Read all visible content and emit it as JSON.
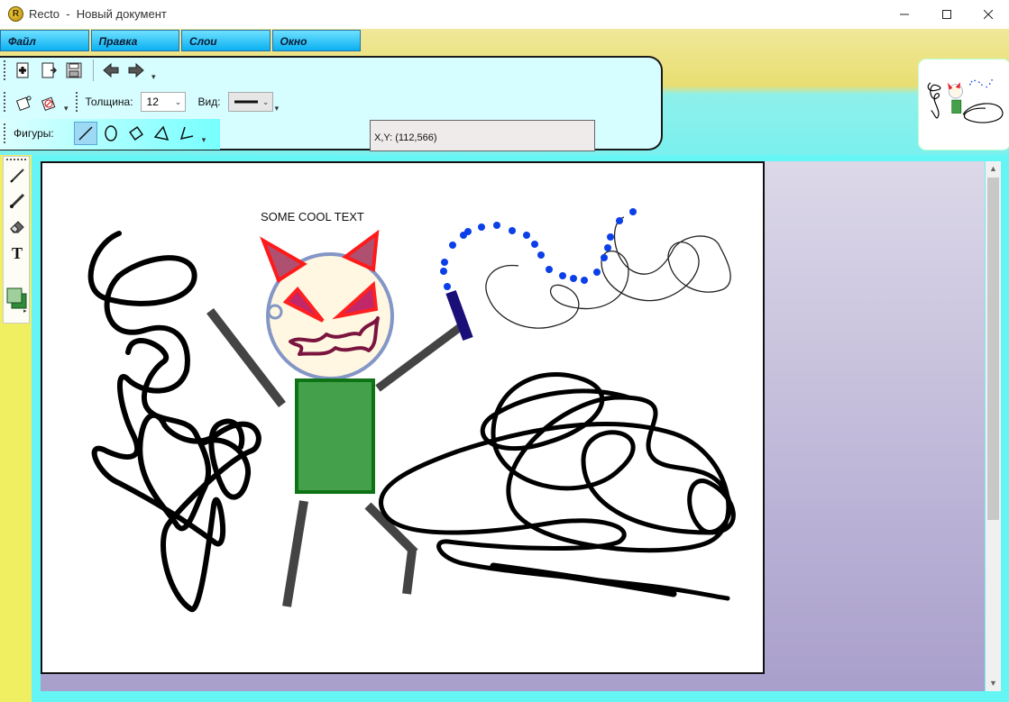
{
  "window": {
    "app_name": "Recto",
    "separator": "-",
    "document_title": "Новый документ",
    "logo_letter": "R"
  },
  "menu": [
    {
      "label": "Файл"
    },
    {
      "label": "Правка"
    },
    {
      "label": "Слои"
    },
    {
      "label": "Окно"
    }
  ],
  "toolbar": {
    "file_icons": [
      "new-document-icon",
      "open-document-icon",
      "save-icon",
      "undo-arrow-icon",
      "redo-arrow-icon"
    ],
    "thickness_label": "Толщина:",
    "thickness_value": "12",
    "style_label": "Вид:",
    "shapes_label": "Фигуры:",
    "shape_icons": [
      "line-icon",
      "ellipse-icon",
      "rhombus-icon",
      "triangle-icon",
      "polyline-icon"
    ],
    "selected_shape": "line-icon"
  },
  "status": {
    "coords": "X,Y: (112,566)"
  },
  "left_tools": [
    "pencil-icon",
    "brush-icon",
    "eraser-icon",
    "text-tool-icon",
    "color-swatch-icon"
  ],
  "canvas": {
    "text_label": "SOME COOL TEXT"
  },
  "colors": {
    "menu_blue": "#0ab0f2",
    "workspace_cyan": "#66f5f5",
    "left_bar_yellow": "#f0ef62",
    "body_green": "#44a04a",
    "devil_red": "#ff2020",
    "dot_blue": "#1040f0"
  }
}
